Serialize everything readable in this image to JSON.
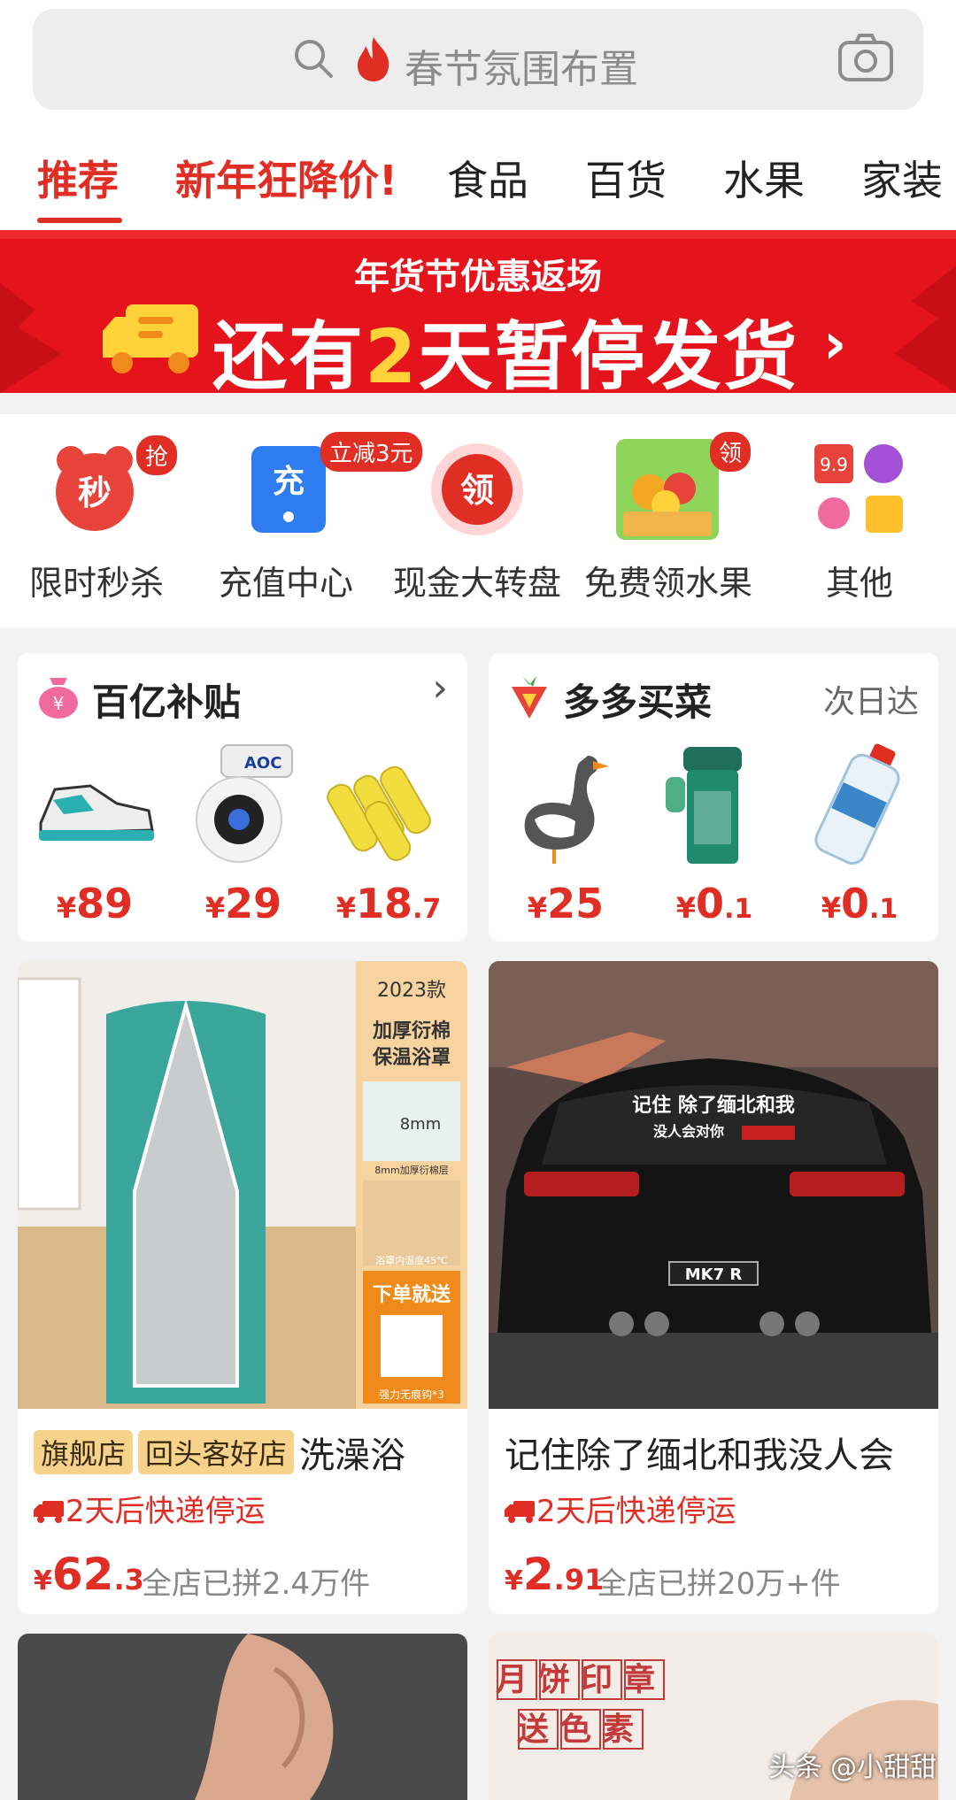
{
  "search": {
    "placeholder": "春节氛围布置"
  },
  "tabs": [
    {
      "label": "推荐"
    },
    {
      "label": "新年狂降价!"
    },
    {
      "label": "食品"
    },
    {
      "label": "百货"
    },
    {
      "label": "水果"
    },
    {
      "label": "家装"
    }
  ],
  "banner": {
    "subtitle": "年货节优惠返场",
    "main_prefix": "还有",
    "main_number": "2",
    "main_suffix": "天暂停发货",
    "chevron": "›"
  },
  "quick_icons": [
    {
      "label": "限时秒杀",
      "glyph": "秒",
      "badge": "抢",
      "icon": "alarm-clock-icon",
      "color": "#e8433a"
    },
    {
      "label": "充值中心",
      "glyph": "充",
      "badge": "立减3元",
      "icon": "phone-recharge-icon",
      "color": "#2f7bf0"
    },
    {
      "label": "现金大转盘",
      "glyph": "领",
      "badge": "",
      "icon": "spin-wheel-icon",
      "color": "#e02e24"
    },
    {
      "label": "免费领水果",
      "glyph": "",
      "badge": "领",
      "icon": "fruit-basket-icon",
      "color": "#7cc24a"
    },
    {
      "label": "其他",
      "glyph": "",
      "badge": "",
      "icon": "more-apps-icon",
      "color": "#e02e24"
    }
  ],
  "subsidy_card": {
    "title": "百亿补贴",
    "chevron": "›",
    "items": [
      {
        "icon": "sneaker-icon",
        "price_yen": "¥",
        "price_int": "89",
        "price_dec": ""
      },
      {
        "icon": "security-camera-icon",
        "price_yen": "¥",
        "price_int": "29",
        "price_dec": ""
      },
      {
        "icon": "corn-icon",
        "price_yen": "¥",
        "price_int": "18",
        "price_dec": ".7"
      }
    ],
    "camera_brand": "AOC"
  },
  "grocery_card": {
    "title": "多多买菜",
    "right_text": "次日达",
    "items": [
      {
        "icon": "goose-icon",
        "price_yen": "¥",
        "price_int": "25",
        "price_dec": ""
      },
      {
        "icon": "tumbler-icon",
        "price_yen": "¥",
        "price_int": "0",
        "price_dec": ".1"
      },
      {
        "icon": "water-bottle-icon",
        "price_yen": "¥",
        "price_int": "0",
        "price_dec": ".1"
      }
    ]
  },
  "feed": [
    {
      "tags": [
        "旗舰店",
        "回头客好店"
      ],
      "title": "洗澡浴",
      "shipping": "2天后快递停运",
      "price_yen": "¥",
      "price_int": "62",
      "price_dec": ".3",
      "sold": "全店已拼2.4万件",
      "image_texts": [
        "2023款",
        "加厚衍棉",
        "保温浴罩",
        "8mm",
        "8mm加厚衍棉层",
        "浴罩内温度45℃",
        "下单就送",
        "强力无痕钩*3"
      ]
    },
    {
      "tags": [],
      "title": "记住除了缅北和我没人会",
      "shipping": "2天后快递停运",
      "price_yen": "¥",
      "price_int": "2",
      "price_dec": ".91",
      "sold": "全店已拼20万+件",
      "image_texts": [
        "记住 除了缅北和我",
        "没人会对你",
        "MK7 R"
      ]
    }
  ],
  "feed_next": [
    {
      "image_texts": []
    },
    {
      "image_texts": [
        "月饼印章",
        "送色素"
      ]
    }
  ],
  "watermark": "头条 @小甜甜",
  "colors": {
    "brand_red": "#e02e24",
    "banner_red": "#e5141c",
    "accent_yellow": "#ffd23a"
  }
}
